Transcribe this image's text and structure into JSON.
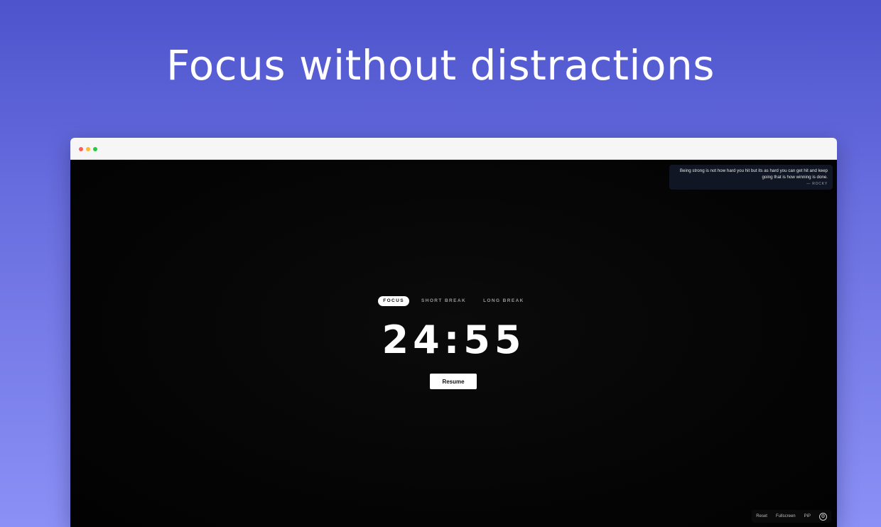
{
  "headline": "Focus without distractions",
  "quote": {
    "text": "Being strong is not how hard you hit but its as hard you can get hit and keep going that is how winning is done.",
    "author": "— ROCKY"
  },
  "modes": [
    {
      "label": "FOCUS",
      "active": true
    },
    {
      "label": "SHORT BREAK",
      "active": false
    },
    {
      "label": "LONG BREAK",
      "active": false
    }
  ],
  "timer": "24:55",
  "resume_label": "Resume",
  "bottom_bar": {
    "reset": "Reset",
    "fullscreen": "Fullscreen",
    "pip": "PiP",
    "settings_icon": "gear-icon"
  },
  "colors": {
    "background_top": "#4d54cc",
    "background_bottom": "#8a90f5",
    "screen": "#050505",
    "quote_bg": "#111624",
    "accent": "#ffffff"
  }
}
